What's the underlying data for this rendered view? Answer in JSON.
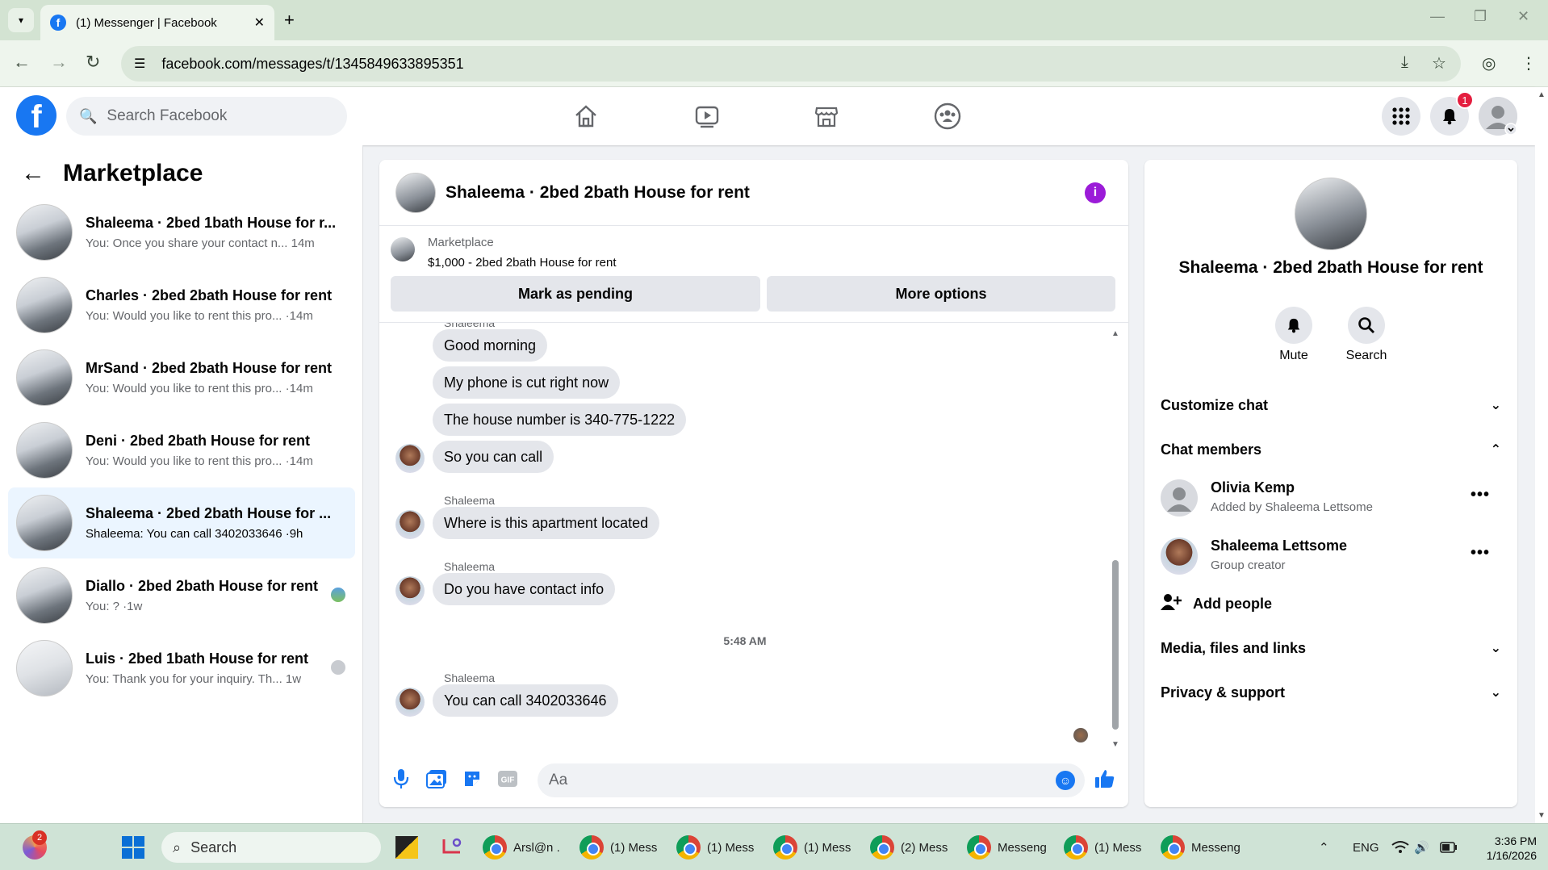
{
  "browser": {
    "tab_title": "(1) Messenger | Facebook",
    "url": "facebook.com/messages/t/1345849633895351"
  },
  "header": {
    "search_placeholder": "Search Facebook",
    "notification_count": "1"
  },
  "left_panel": {
    "title": "Marketplace",
    "conversations": [
      {
        "name": "Shaleema · 2bed 1bath House for r...",
        "preview": "You: Once you share your contact n...",
        "time": "14m"
      },
      {
        "name": "Charles · 2bed 2bath House for rent",
        "preview": "You: Would you like to rent this pro... ·",
        "time": "14m"
      },
      {
        "name": "MrSand · 2bed 2bath House for rent",
        "preview": "You: Would you like to rent this pro... ·",
        "time": "14m"
      },
      {
        "name": "Deni · 2bed 2bath House for rent",
        "preview": "You: Would you like to rent this pro... ·",
        "time": "14m"
      },
      {
        "name": "Shaleema · 2bed 2bath House for ...",
        "preview": "Shaleema: You can call 3402033646 ·",
        "time": "9h"
      },
      {
        "name": "Diallo · 2bed 2bath House for rent",
        "preview": "You: ? ·",
        "time": "1w"
      },
      {
        "name": "Luis · 2bed 1bath House for rent",
        "preview": "You: Thank you for your inquiry. Th...",
        "time": "1w"
      }
    ]
  },
  "chat": {
    "title": "Shaleema · 2bed 2bath House for rent",
    "marketplace_label": "Marketplace",
    "listing": "$1,000 - 2bed 2bath House for rent",
    "mark_pending": "Mark as pending",
    "more_options": "More options",
    "sender_name": "Shaleema",
    "timestamp": "5:48 AM",
    "messages": [
      "Good morning",
      "My phone is cut right now",
      "The house number is 340-775-1222",
      "So you can call",
      "Where is this apartment located",
      "Do you have contact info",
      "You can call 3402033646"
    ],
    "composer_placeholder": "Aa"
  },
  "right_panel": {
    "title": "Shaleema · 2bed 2bath House for rent",
    "mute": "Mute",
    "search": "Search",
    "customize": "Customize chat",
    "chat_members": "Chat members",
    "members": [
      {
        "name": "Olivia Kemp",
        "sub": "Added by Shaleema Lettsome"
      },
      {
        "name": "Shaleema Lettsome",
        "sub": "Group creator"
      }
    ],
    "add_people": "Add people",
    "media": "Media, files and links",
    "privacy": "Privacy & support"
  },
  "taskbar": {
    "search": "Search",
    "items": [
      "Arsl@n .",
      "(1) Mess",
      "(1) Mess",
      "(1) Mess",
      "(2) Mess",
      "Messeng",
      "(1) Mess",
      "Messeng"
    ],
    "copilot_badge": "2",
    "lang": "ENG",
    "time": "3:36 PM",
    "date": "1/16/2026"
  }
}
